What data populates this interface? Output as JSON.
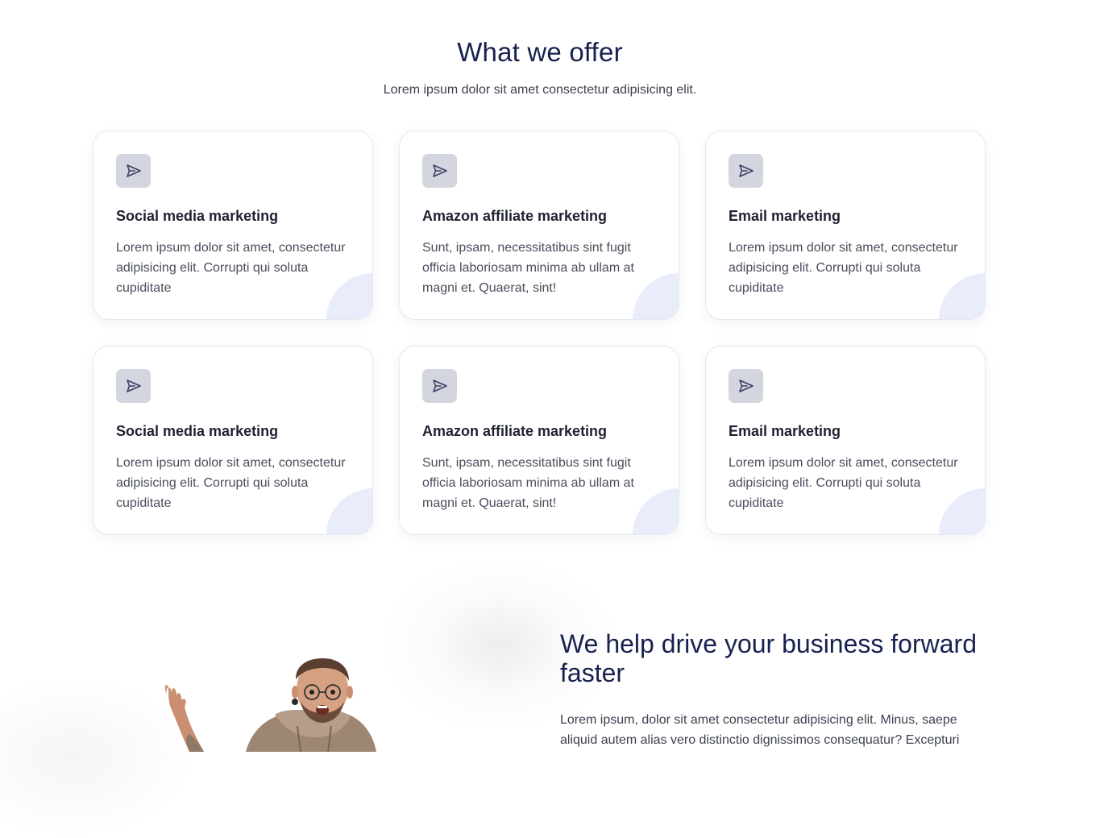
{
  "offer": {
    "title": "What we offer",
    "subtitle": "Lorem ipsum dolor sit amet consectetur adipisicing elit."
  },
  "cards": [
    {
      "icon": "send-icon",
      "title": "Social media marketing",
      "text": "Lorem ipsum dolor sit amet, consectetur adipisicing elit. Corrupti qui soluta cupiditate"
    },
    {
      "icon": "send-icon",
      "title": "Amazon affiliate marketing",
      "text": "Sunt, ipsam, necessitatibus sint fugit officia laboriosam minima ab ullam at magni et. Quaerat, sint!"
    },
    {
      "icon": "send-icon",
      "title": "Email marketing",
      "text": "Lorem ipsum dolor sit amet, consectetur adipisicing elit. Corrupti qui soluta cupiditate"
    },
    {
      "icon": "send-icon",
      "title": "Social media marketing",
      "text": "Lorem ipsum dolor sit amet, consectetur adipisicing elit. Corrupti qui soluta cupiditate"
    },
    {
      "icon": "send-icon",
      "title": "Amazon affiliate marketing",
      "text": "Sunt, ipsam, necessitatibus sint fugit officia laboriosam minima ab ullam at magni et. Quaerat, sint!"
    },
    {
      "icon": "send-icon",
      "title": "Email marketing",
      "text": "Lorem ipsum dolor sit amet, consectetur adipisicing elit. Corrupti qui soluta cupiditate"
    }
  ],
  "help": {
    "title": "We help drive your business forward faster",
    "text": "Lorem ipsum, dolor sit amet consectetur adipisicing elit. Minus, saepe aliquid autem alias vero distinctio dignissimos consequatur? Excepturi"
  },
  "colors": {
    "heading": "#17214f",
    "icon_bg": "#d3d6de",
    "corner_accent": "#e8ecfb"
  }
}
